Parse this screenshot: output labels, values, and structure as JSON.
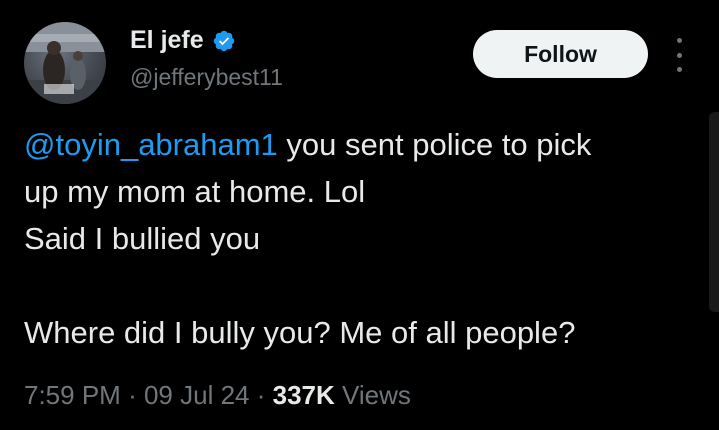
{
  "author": {
    "display_name": "El jefe",
    "handle": "@jefferybest11",
    "verified_icon": "verified-badge-icon",
    "verified_color": "#1d9bf0"
  },
  "actions": {
    "follow_label": "Follow",
    "more_icon": "more-options-icon"
  },
  "tweet": {
    "mention": "@toyin_abraham1",
    "line1_rest": " you sent police to pick",
    "line2": "up my mom at home. Lol",
    "line3": "Said I bullied you",
    "line4": "",
    "line5": "Where did I bully you? Me of all people?"
  },
  "meta": {
    "time": "7:59 PM",
    "separator": "·",
    "date": "09 Jul 24",
    "views_count": "337K",
    "views_label": "Views"
  },
  "colors": {
    "background": "#000000",
    "text": "#e7e9ea",
    "secondary": "#71767b",
    "link": "#1d9bf0",
    "button_bg": "#eff3f4"
  }
}
